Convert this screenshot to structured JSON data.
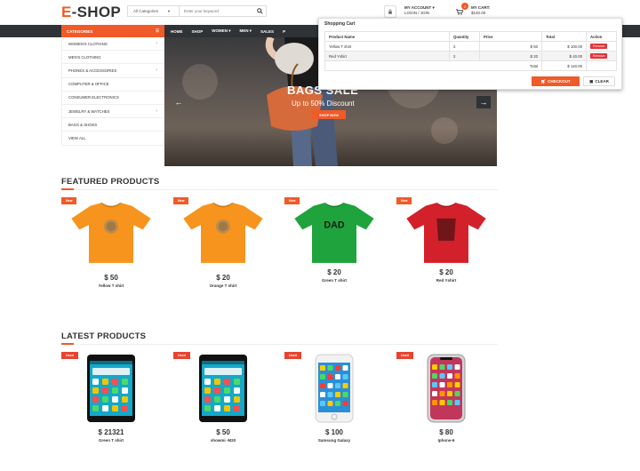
{
  "header": {
    "logo_first": "E",
    "logo_rest": "-SHOP",
    "search": {
      "category": "All Categories",
      "placeholder": "Enter your keyword"
    },
    "account": {
      "title": "MY ACCOUNT ▾",
      "subtitle": "LOGIN / JOIN"
    },
    "cart": {
      "title": "MY CART:",
      "amount": "$140.00",
      "count": "2"
    }
  },
  "nav": {
    "categories_label": "CATEGORIES",
    "links": [
      "HOME",
      "SHOP",
      "WOMEN ▾",
      "MEN ▾",
      "SALES",
      "P"
    ]
  },
  "sidebar": {
    "items": [
      {
        "label": "WOMEN'S CLOTHING",
        "chevron": "›"
      },
      {
        "label": "MEN'S CLOTHING",
        "chevron": ""
      },
      {
        "label": "PHONES & ACCESSORIES",
        "chevron": "›"
      },
      {
        "label": "COMPUTER & OFFICE",
        "chevron": ""
      },
      {
        "label": "CONSUMER ELECTRONICS",
        "chevron": ""
      },
      {
        "label": "JEWELRY & WATCHES",
        "chevron": "›"
      },
      {
        "label": "BAGS & SHOES",
        "chevron": ""
      },
      {
        "label": "VIEW ALL",
        "chevron": ""
      }
    ]
  },
  "hero": {
    "title": "BAGS SALE",
    "subtitle": "Up to 50% Discount",
    "button": "SHOP NOW"
  },
  "cart_dropdown": {
    "heading": "Shopping Cart",
    "columns": [
      "Product Name",
      "Quantity",
      "Price",
      "Total",
      "Action"
    ],
    "rows": [
      {
        "name": "Yellow T shirt",
        "qty": "2",
        "price": "$ 50",
        "total": "$ 100.00",
        "action": "Remove"
      },
      {
        "name": "Red Yshirt",
        "qty": "2",
        "price": "$ 20",
        "total": "$ 40.00",
        "action": "Remove"
      }
    ],
    "total_label": "Total",
    "total_value": "$ 140.00",
    "checkout": "CHECKOUT",
    "clear": "CLEAR"
  },
  "featured": {
    "title": "FEATURED PRODUCTS",
    "items": [
      {
        "badge": "New",
        "price": "$ 50",
        "name": "Yellow T shirt",
        "color": "#f7941d",
        "print": "",
        "print_color": ""
      },
      {
        "badge": "New",
        "price": "$ 20",
        "name": "Orange T shirt",
        "color": "#f7941d",
        "print": "",
        "print_color": ""
      },
      {
        "badge": "New",
        "price": "$ 20",
        "name": "Green T shirt",
        "color": "#1fa33c",
        "print": "DAD",
        "print_color": "#1a1a1a"
      },
      {
        "badge": "New",
        "price": "$ 20",
        "name": "Red Yshirt",
        "color": "#d3212b",
        "print": "",
        "print_color": ""
      }
    ]
  },
  "latest": {
    "title": "LATEST PRODUCTS",
    "items": [
      {
        "badge": "Used",
        "price": "$ 21321",
        "name": "Green T shirt",
        "style": "android"
      },
      {
        "badge": "Used",
        "price": "$ 50",
        "name": "showmi -M20",
        "style": "android"
      },
      {
        "badge": "Used",
        "price": "$ 100",
        "name": "Samsung Galaxy",
        "style": "iphone-white"
      },
      {
        "badge": "Used",
        "price": "$ 80",
        "name": "Iphone-6",
        "style": "iphone-x"
      }
    ]
  }
}
